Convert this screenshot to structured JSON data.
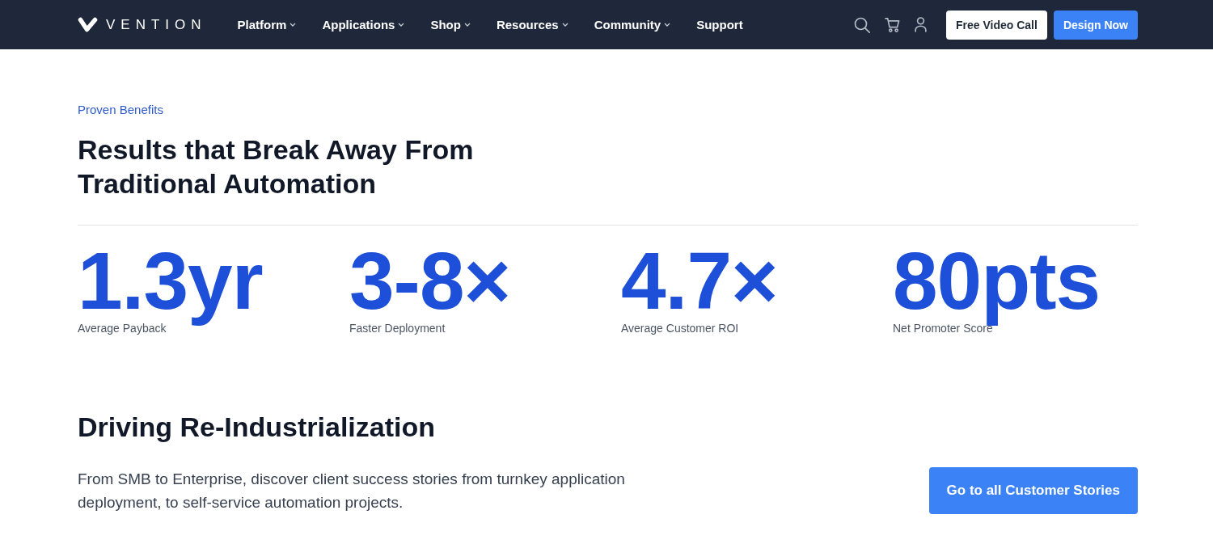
{
  "header": {
    "logo": "VENTION",
    "nav": [
      {
        "label": "Platform",
        "dropdown": true
      },
      {
        "label": "Applications",
        "dropdown": true
      },
      {
        "label": "Shop",
        "dropdown": true
      },
      {
        "label": "Resources",
        "dropdown": true
      },
      {
        "label": "Community",
        "dropdown": true
      },
      {
        "label": "Support",
        "dropdown": false
      }
    ],
    "buttons": [
      {
        "label": "Free Video Call",
        "kind": "secondary"
      },
      {
        "label": "Design Now",
        "kind": "primary"
      }
    ]
  },
  "benefits": {
    "eyebrow": "Proven Benefits",
    "heading": "Results that Break Away From Traditional Automation",
    "stats": [
      {
        "value": "1.3yr",
        "label": "Average Payback"
      },
      {
        "value": "3-8×",
        "label": "Faster Deployment"
      },
      {
        "value": "4.7×",
        "label": "Average Customer ROI"
      },
      {
        "value": "80pts",
        "label": "Net Promoter Score"
      }
    ]
  },
  "stories": {
    "heading": "Driving Re-Industrialization",
    "description": "From SMB to Enterprise, discover client success stories from turnkey application deployment, to self-service automation projects.",
    "button": "Go to all Customer Stories"
  }
}
